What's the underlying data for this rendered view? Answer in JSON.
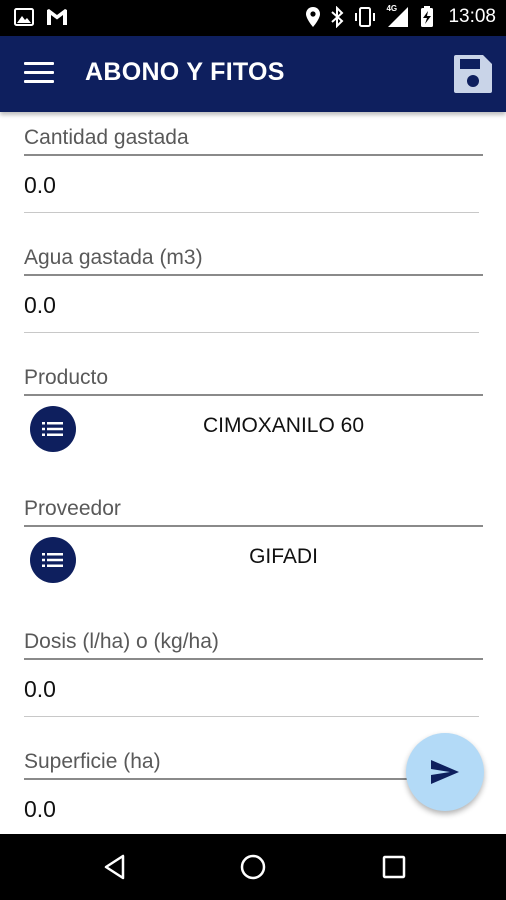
{
  "status_bar": {
    "time": "13:08",
    "left_icons": [
      "image-icon",
      "gmail-icon"
    ],
    "right_icons": [
      "location-icon",
      "bluetooth-icon",
      "vibrate-icon",
      "signal-4g-icon",
      "battery-charging-icon"
    ],
    "network_label": "4G"
  },
  "app_bar": {
    "title": "ABONO Y FITOS",
    "left_icon": "menu-icon",
    "right_icon": "save-icon"
  },
  "form": {
    "cantidad_gastada": {
      "label": "Cantidad gastada",
      "value": "0.0"
    },
    "agua_gastada": {
      "label": "Agua gastada (m3)",
      "value": "0.0"
    },
    "producto": {
      "label": "Producto",
      "value": "CIMOXANILO 60",
      "icon": "list-icon"
    },
    "proveedor": {
      "label": "Proveedor",
      "value": "GIFADI",
      "icon": "list-icon"
    },
    "dosis": {
      "label": "Dosis (l/ha) o (kg/ha)",
      "value": "0.0"
    },
    "superficie": {
      "label": "Superficie (ha)",
      "value": "0.0"
    }
  },
  "fab": {
    "icon": "send-icon"
  },
  "nav_bar": {
    "buttons": [
      "back-icon",
      "home-icon",
      "recents-icon"
    ]
  },
  "colors": {
    "primary": "#0e1f5e",
    "fab": "#b3daf7",
    "status_bar": "#000000"
  }
}
